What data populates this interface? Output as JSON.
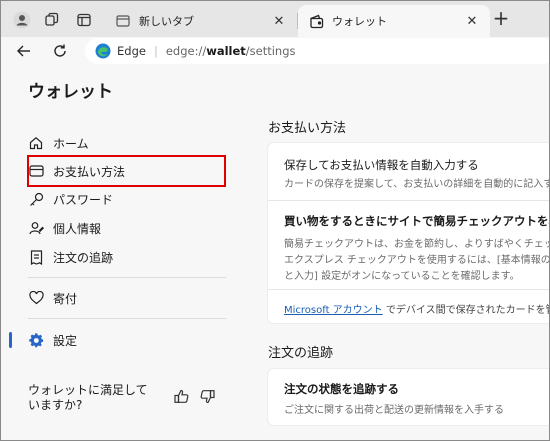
{
  "tabs": [
    {
      "title": "新しいタブ"
    },
    {
      "title": "ウォレット"
    }
  ],
  "addressbar": {
    "brand": "Edge",
    "url_scheme": "edge://",
    "url_host": "wallet",
    "url_path": "/settings"
  },
  "sidebar": {
    "title": "ウォレット",
    "items": [
      {
        "label": "ホーム",
        "icon": "home-icon"
      },
      {
        "label": "お支払い方法",
        "icon": "credit-card-icon"
      },
      {
        "label": "パスワード",
        "icon": "key-icon"
      },
      {
        "label": "個人情報",
        "icon": "person-icon"
      },
      {
        "label": "注文の追跡",
        "icon": "receipt-icon"
      },
      {
        "label": "寄付",
        "icon": "heart-icon"
      },
      {
        "label": "設定",
        "icon": "gear-icon"
      }
    ],
    "feedback": "ウォレットに満足していますか?"
  },
  "main": {
    "payment_section_title": "お支払い方法",
    "payment_card": {
      "autofill_title": "保存してお支払い情報を自動入力する",
      "autofill_desc": "カードの保存を提案して、お支払いの詳細を自動的に記入する",
      "express_title": "買い物をするときにサイトで簡易チェックアウトを表",
      "express_desc_1": "簡易チェックアウトは、お金を節約し、よりすばやくチェック",
      "express_desc_2": "エクスプレス チェックアウトを使用するには、[基本情報の保",
      "express_desc_3": "と入力] 設定がオンになっていることを確認します。",
      "footer_link": "Microsoft アカウント",
      "footer_text": " でデバイス間で保存されたカードを管理"
    },
    "tracking_section_title": "注文の追跡",
    "tracking_card": {
      "title": "注文の状態を追跡する",
      "desc": "ご注文に関する出荷と配送の更新情報を入手する"
    }
  },
  "colors": {
    "accent": "#2a66c6",
    "highlight": "#e00000",
    "link": "#1a5fb4"
  }
}
